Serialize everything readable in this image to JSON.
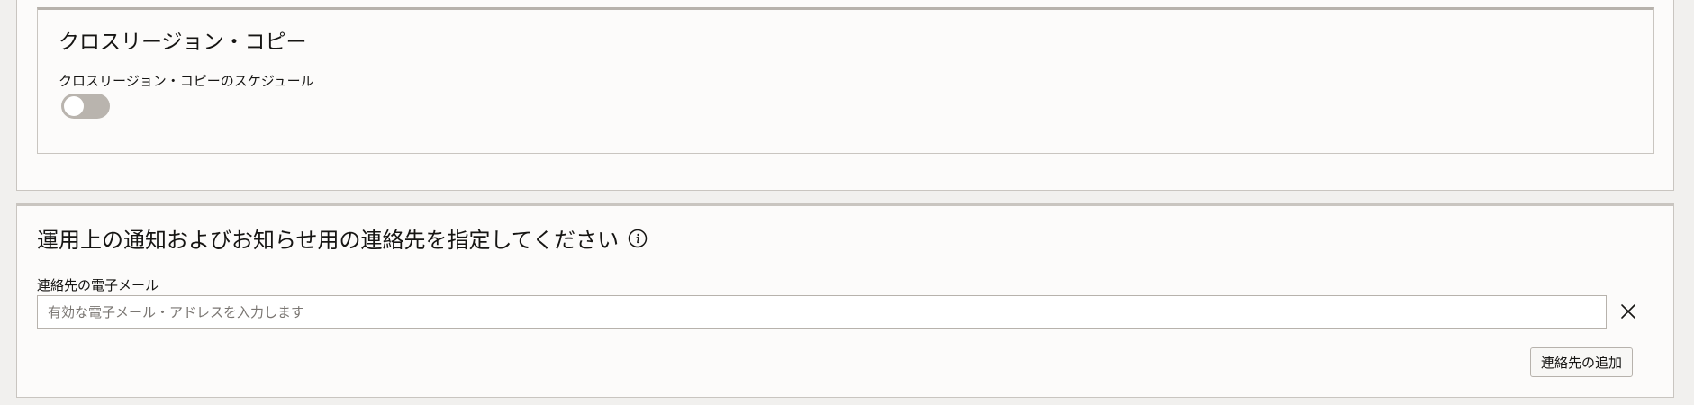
{
  "cross_region": {
    "title": "クロスリージョン・コピー",
    "schedule_label": "クロスリージョン・コピーのスケジュール",
    "schedule_enabled": false
  },
  "contacts": {
    "title": "運用上の通知およびお知らせ用の連絡先を指定してください",
    "info_icon": "info-icon",
    "email_label": "連絡先の電子メール",
    "email_value": "",
    "email_placeholder": "有効な電子メール・アドレスを入力します",
    "clear_icon": "close-icon",
    "add_button_label": "連絡先の追加"
  },
  "colors": {
    "toggle_off": "#b9b4ae",
    "border": "#c9c5c0",
    "panel_bg": "#fcfbfa",
    "page_bg": "#f1f0ee"
  }
}
